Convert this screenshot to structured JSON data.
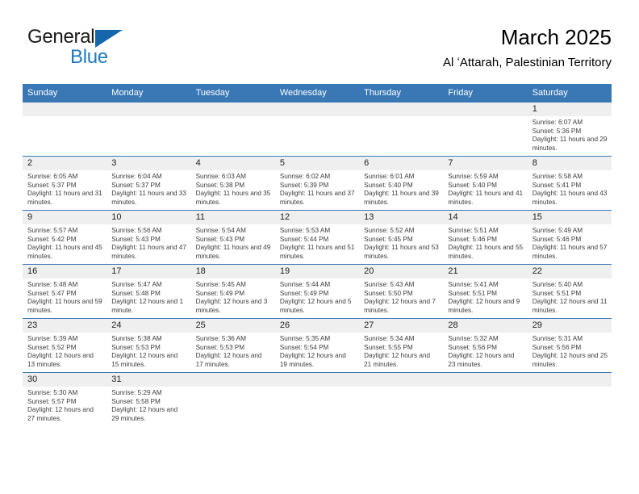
{
  "brand": {
    "name_part1": "General",
    "name_part2": "Blue",
    "flag_icon": "blue-triangle-flag",
    "colors": {
      "text_dark": "#1a1a1a",
      "blue": "#1f7ac0",
      "flag": "#1566ab"
    }
  },
  "header": {
    "title": "March 2025",
    "subtitle": "Al ʻAttarah, Palestinian Territory"
  },
  "theme": {
    "header_blue": "#3a78b5",
    "daynum_band": "#efefef",
    "cell_text": "#3d3d3d"
  },
  "weekdays": [
    "Sunday",
    "Monday",
    "Tuesday",
    "Wednesday",
    "Thursday",
    "Friday",
    "Saturday"
  ],
  "weeks": [
    [
      {
        "day": "",
        "sunrise": "",
        "sunset": "",
        "daylight": ""
      },
      {
        "day": "",
        "sunrise": "",
        "sunset": "",
        "daylight": ""
      },
      {
        "day": "",
        "sunrise": "",
        "sunset": "",
        "daylight": ""
      },
      {
        "day": "",
        "sunrise": "",
        "sunset": "",
        "daylight": ""
      },
      {
        "day": "",
        "sunrise": "",
        "sunset": "",
        "daylight": ""
      },
      {
        "day": "",
        "sunrise": "",
        "sunset": "",
        "daylight": ""
      },
      {
        "day": "1",
        "sunrise": "Sunrise: 6:07 AM",
        "sunset": "Sunset: 5:36 PM",
        "daylight": "Daylight: 11 hours and 29 minutes."
      }
    ],
    [
      {
        "day": "2",
        "sunrise": "Sunrise: 6:05 AM",
        "sunset": "Sunset: 5:37 PM",
        "daylight": "Daylight: 11 hours and 31 minutes."
      },
      {
        "day": "3",
        "sunrise": "Sunrise: 6:04 AM",
        "sunset": "Sunset: 5:37 PM",
        "daylight": "Daylight: 11 hours and 33 minutes."
      },
      {
        "day": "4",
        "sunrise": "Sunrise: 6:03 AM",
        "sunset": "Sunset: 5:38 PM",
        "daylight": "Daylight: 11 hours and 35 minutes."
      },
      {
        "day": "5",
        "sunrise": "Sunrise: 6:02 AM",
        "sunset": "Sunset: 5:39 PM",
        "daylight": "Daylight: 11 hours and 37 minutes."
      },
      {
        "day": "6",
        "sunrise": "Sunrise: 6:01 AM",
        "sunset": "Sunset: 5:40 PM",
        "daylight": "Daylight: 11 hours and 39 minutes."
      },
      {
        "day": "7",
        "sunrise": "Sunrise: 5:59 AM",
        "sunset": "Sunset: 5:40 PM",
        "daylight": "Daylight: 11 hours and 41 minutes."
      },
      {
        "day": "8",
        "sunrise": "Sunrise: 5:58 AM",
        "sunset": "Sunset: 5:41 PM",
        "daylight": "Daylight: 11 hours and 43 minutes."
      }
    ],
    [
      {
        "day": "9",
        "sunrise": "Sunrise: 5:57 AM",
        "sunset": "Sunset: 5:42 PM",
        "daylight": "Daylight: 11 hours and 45 minutes."
      },
      {
        "day": "10",
        "sunrise": "Sunrise: 5:56 AM",
        "sunset": "Sunset: 5:43 PM",
        "daylight": "Daylight: 11 hours and 47 minutes."
      },
      {
        "day": "11",
        "sunrise": "Sunrise: 5:54 AM",
        "sunset": "Sunset: 5:43 PM",
        "daylight": "Daylight: 11 hours and 49 minutes."
      },
      {
        "day": "12",
        "sunrise": "Sunrise: 5:53 AM",
        "sunset": "Sunset: 5:44 PM",
        "daylight": "Daylight: 11 hours and 51 minutes."
      },
      {
        "day": "13",
        "sunrise": "Sunrise: 5:52 AM",
        "sunset": "Sunset: 5:45 PM",
        "daylight": "Daylight: 11 hours and 53 minutes."
      },
      {
        "day": "14",
        "sunrise": "Sunrise: 5:51 AM",
        "sunset": "Sunset: 5:46 PM",
        "daylight": "Daylight: 11 hours and 55 minutes."
      },
      {
        "day": "15",
        "sunrise": "Sunrise: 5:49 AM",
        "sunset": "Sunset: 5:46 PM",
        "daylight": "Daylight: 11 hours and 57 minutes."
      }
    ],
    [
      {
        "day": "16",
        "sunrise": "Sunrise: 5:48 AM",
        "sunset": "Sunset: 5:47 PM",
        "daylight": "Daylight: 11 hours and 59 minutes."
      },
      {
        "day": "17",
        "sunrise": "Sunrise: 5:47 AM",
        "sunset": "Sunset: 5:48 PM",
        "daylight": "Daylight: 12 hours and 1 minute."
      },
      {
        "day": "18",
        "sunrise": "Sunrise: 5:45 AM",
        "sunset": "Sunset: 5:49 PM",
        "daylight": "Daylight: 12 hours and 3 minutes."
      },
      {
        "day": "19",
        "sunrise": "Sunrise: 5:44 AM",
        "sunset": "Sunset: 5:49 PM",
        "daylight": "Daylight: 12 hours and 5 minutes."
      },
      {
        "day": "20",
        "sunrise": "Sunrise: 5:43 AM",
        "sunset": "Sunset: 5:50 PM",
        "daylight": "Daylight: 12 hours and 7 minutes."
      },
      {
        "day": "21",
        "sunrise": "Sunrise: 5:41 AM",
        "sunset": "Sunset: 5:51 PM",
        "daylight": "Daylight: 12 hours and 9 minutes."
      },
      {
        "day": "22",
        "sunrise": "Sunrise: 5:40 AM",
        "sunset": "Sunset: 5:51 PM",
        "daylight": "Daylight: 12 hours and 11 minutes."
      }
    ],
    [
      {
        "day": "23",
        "sunrise": "Sunrise: 5:39 AM",
        "sunset": "Sunset: 5:52 PM",
        "daylight": "Daylight: 12 hours and 13 minutes."
      },
      {
        "day": "24",
        "sunrise": "Sunrise: 5:38 AM",
        "sunset": "Sunset: 5:53 PM",
        "daylight": "Daylight: 12 hours and 15 minutes."
      },
      {
        "day": "25",
        "sunrise": "Sunrise: 5:36 AM",
        "sunset": "Sunset: 5:53 PM",
        "daylight": "Daylight: 12 hours and 17 minutes."
      },
      {
        "day": "26",
        "sunrise": "Sunrise: 5:35 AM",
        "sunset": "Sunset: 5:54 PM",
        "daylight": "Daylight: 12 hours and 19 minutes."
      },
      {
        "day": "27",
        "sunrise": "Sunrise: 5:34 AM",
        "sunset": "Sunset: 5:55 PM",
        "daylight": "Daylight: 12 hours and 21 minutes."
      },
      {
        "day": "28",
        "sunrise": "Sunrise: 5:32 AM",
        "sunset": "Sunset: 5:56 PM",
        "daylight": "Daylight: 12 hours and 23 minutes."
      },
      {
        "day": "29",
        "sunrise": "Sunrise: 5:31 AM",
        "sunset": "Sunset: 5:56 PM",
        "daylight": "Daylight: 12 hours and 25 minutes."
      }
    ],
    [
      {
        "day": "30",
        "sunrise": "Sunrise: 5:30 AM",
        "sunset": "Sunset: 5:57 PM",
        "daylight": "Daylight: 12 hours and 27 minutes."
      },
      {
        "day": "31",
        "sunrise": "Sunrise: 5:29 AM",
        "sunset": "Sunset: 5:58 PM",
        "daylight": "Daylight: 12 hours and 29 minutes."
      },
      {
        "day": "",
        "sunrise": "",
        "sunset": "",
        "daylight": ""
      },
      {
        "day": "",
        "sunrise": "",
        "sunset": "",
        "daylight": ""
      },
      {
        "day": "",
        "sunrise": "",
        "sunset": "",
        "daylight": ""
      },
      {
        "day": "",
        "sunrise": "",
        "sunset": "",
        "daylight": ""
      },
      {
        "day": "",
        "sunrise": "",
        "sunset": "",
        "daylight": ""
      }
    ]
  ]
}
